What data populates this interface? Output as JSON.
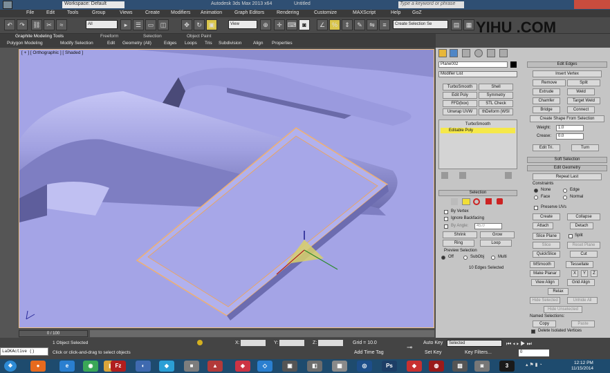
{
  "window": {
    "workspace": "Workspace: Default",
    "title": "Autodesk 3ds Max 2013 x64",
    "doc": "Untitled",
    "search_placeholder": "Type a keyword or phrase"
  },
  "menu": [
    "File",
    "Edit",
    "Tools",
    "Group",
    "Views",
    "Create",
    "Modifiers",
    "Animation",
    "Graph Editors",
    "Rendering",
    "Customize",
    "MAXScript",
    "Help",
    "GoZ"
  ],
  "toolbar": {
    "filter": "All",
    "view": "View",
    "selection_set": "Create Selection Se"
  },
  "watermark": "YIHU  .COM",
  "ribbon": {
    "tabs": [
      "Graphite Modeling Tools",
      "Freeform",
      "Selection",
      "Object Paint"
    ],
    "subtabs": [
      "Polygon Modeling",
      "Modify Selection",
      "Edit",
      "Geometry (All)",
      "Edges",
      "Loops",
      "Tris",
      "Subdivision",
      "Align",
      "Properties"
    ]
  },
  "viewport": {
    "label": "[ + ] [ Orthographic ] [ Shaded ]"
  },
  "modify_panel": {
    "object_name": "Plane002",
    "modifier_list": "Modifier List",
    "modifier_buttons": [
      "TurboSmooth",
      "Shell",
      "Edit Poly",
      "Symmetry",
      "FFD(box)",
      "STL Check",
      "Unwrap UVW",
      "thDeform (WSI"
    ],
    "stack": [
      "TurboSmooth",
      "Editable Poly"
    ],
    "selection": {
      "header": "Selection",
      "by_vertex": "By Vertex",
      "ignore_backfacing": "Ignore Backfacing",
      "by_angle": "By Angle:",
      "angle_value": "45.0",
      "shrink": "Shrink",
      "grow": "Grow",
      "ring": "Ring",
      "loop": "Loop",
      "preview_header": "Preview Selection",
      "preview_off": "Off",
      "preview_subobj": "SubObj",
      "preview_multi": "Multi",
      "status": "10 Edges Selected"
    },
    "edit_edges": {
      "header": "Edit Edges",
      "insert_vertex": "Insert Vertex",
      "remove": "Remove",
      "split": "Split",
      "extrude": "Extrude",
      "weld": "Weld",
      "chamfer": "Chamfer",
      "target_weld": "Target Weld",
      "bridge": "Bridge",
      "connect": "Connect",
      "create_shape": "Create Shape From Selection",
      "weight_label": "Weight:",
      "weight": "1.0",
      "crease_label": "Crease:",
      "crease": "0.0",
      "edit_tri": "Edit Tri.",
      "turn": "Turn"
    },
    "soft_selection": "Soft Selection",
    "edit_geometry": {
      "header": "Edit Geometry",
      "repeat_last": "Repeat Last",
      "constraints": "Constraints",
      "none": "None",
      "edge": "Edge",
      "face": "Face",
      "normal": "Normal",
      "preserve_uvs": "Preserve UVs",
      "create": "Create",
      "collapse": "Collapse",
      "attach": "Attach",
      "detach": "Detach",
      "slice_plane": "Slice Plane",
      "split": "Split",
      "slice": "Slice",
      "reset_plane": "Reset Plane",
      "quickslice": "QuickSlice",
      "cut": "Cut",
      "msmooth": "MSmooth",
      "tessellate": "Tessellate",
      "make_planar": "Make Planar",
      "x": "X",
      "y": "Y",
      "z": "Z",
      "view_align": "View Align",
      "grid_align": "Grid Align",
      "relax": "Relax",
      "hide_selected": "Hide Selected",
      "unhide_all": "Unhide All",
      "hide_unselected": "Hide Unselected",
      "named_selections": "Named Selections:",
      "copy": "Copy",
      "paste": "Paste",
      "delete_isolated": "Delete Isolated Vertices"
    }
  },
  "status": {
    "timeline": "0 / 100",
    "objects": "1 Object Selected",
    "prompt": "Click or click-and-drag to select objects",
    "maxscript": "LaDKActive ()",
    "x_label": "X:",
    "y_label": "Y:",
    "z_label": "Z:",
    "grid": "Grid = 10.0",
    "add_time_tag": "Add Time Tag",
    "auto_key": "Auto Key",
    "set_key": "Set Key",
    "key_mode": "Selected",
    "key_filters": "Key Filters...",
    "frame": "0"
  },
  "taskbar": {
    "time": "12:12 PM",
    "date": "11/15/2014",
    "apps": [
      "start",
      "firefox",
      "ie",
      "chrome",
      "explorer",
      "filezilla",
      "app6",
      "app7",
      "app8",
      "dropbox",
      "app10",
      "app11",
      "app12",
      "photoshop",
      "app14",
      "app15",
      "3dsmax"
    ]
  }
}
